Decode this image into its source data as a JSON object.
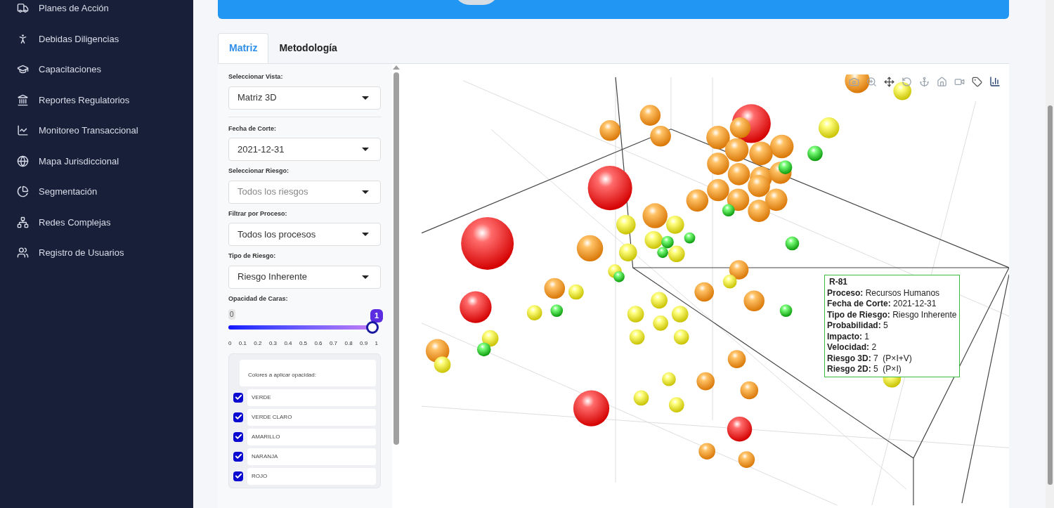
{
  "sidebar": {
    "items": [
      {
        "label": "Planes de Acción",
        "selected": false
      },
      {
        "label": "Debidas Diligencias",
        "selected": false
      },
      {
        "label": "Capacitaciones",
        "selected": false
      },
      {
        "label": "Reportes Regulatorios",
        "selected": false
      },
      {
        "label": "Monitoreo Transaccional",
        "selected": false
      },
      {
        "label": "Mapa Jurisdiccional",
        "selected": false
      },
      {
        "label": "Segmentación",
        "selected": false
      },
      {
        "label": "Redes Complejas",
        "selected": false
      },
      {
        "label": "Registro de Usuarios",
        "selected": false
      }
    ]
  },
  "tabs": [
    {
      "label": "Matriz",
      "selected": true
    },
    {
      "label": "Metodología",
      "selected": false
    }
  ],
  "controls": {
    "selects": [
      {
        "label": "Seleccionar Vista:",
        "value": "Matriz 3D"
      },
      {
        "label": "Fecha de Corte:",
        "value": "2021-12-31"
      },
      {
        "label": "Seleccionar Riesgo:",
        "placeholder": "Todos los riesgos"
      },
      {
        "label": "Filtrar por Proceso:",
        "value": "Todos los procesos"
      },
      {
        "label": "Tipo de Riesgo:",
        "value": "Riesgo Inherente"
      }
    ],
    "slider": {
      "label": "Opacidad de Caras:",
      "min_label": "0",
      "value_label": "1",
      "level": 1,
      "ticks": [
        "0",
        "0.1",
        "0.2",
        "0.3",
        "0.4",
        "0.5",
        "0.6",
        "0.7",
        "0.8",
        "0.9",
        "1"
      ]
    },
    "colors_box": {
      "title": "Colores a aplicar opacidad:",
      "items": [
        {
          "label": "VERDE",
          "checked": true
        },
        {
          "label": "VERDE CLARO",
          "checked": true
        },
        {
          "label": "AMARILLO",
          "checked": true
        },
        {
          "label": "NARANJA",
          "checked": true
        },
        {
          "label": "ROJO",
          "checked": true
        }
      ]
    }
  },
  "tooltip": {
    "title": "R-81",
    "lines": [
      {
        "key": "Proceso:",
        "value": "Recursos Humanos"
      },
      {
        "key": "Fecha de Corte:",
        "value": "2021-12-31"
      },
      {
        "key": "Tipo de Riesgo:",
        "value": "Riesgo Inherente"
      },
      {
        "key": "Probabilidad:",
        "value": "5"
      },
      {
        "key": "Impacto:",
        "value": "1"
      },
      {
        "key": "Velocidad:",
        "value": "2"
      },
      {
        "key": "Riesgo 3D:",
        "value": "7  (P×I+V)"
      },
      {
        "key": "Riesgo 2D:",
        "value": "5  (P×I)"
      }
    ]
  }
}
